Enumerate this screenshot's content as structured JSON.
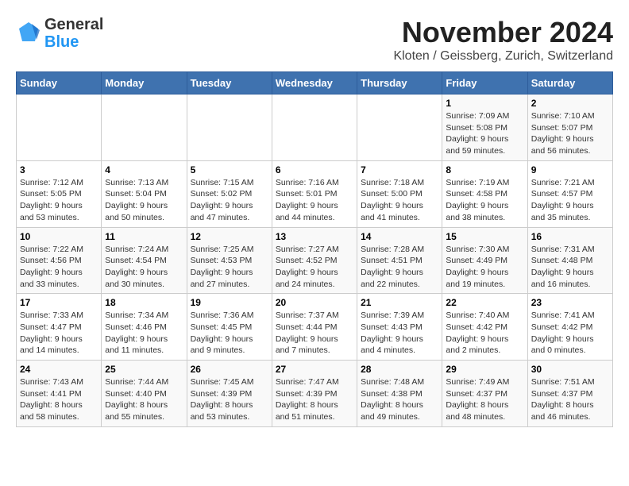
{
  "header": {
    "logo_general": "General",
    "logo_blue": "Blue",
    "month": "November 2024",
    "location": "Kloten / Geissberg, Zurich, Switzerland"
  },
  "weekdays": [
    "Sunday",
    "Monday",
    "Tuesday",
    "Wednesday",
    "Thursday",
    "Friday",
    "Saturday"
  ],
  "weeks": [
    [
      {
        "day": "",
        "info": ""
      },
      {
        "day": "",
        "info": ""
      },
      {
        "day": "",
        "info": ""
      },
      {
        "day": "",
        "info": ""
      },
      {
        "day": "",
        "info": ""
      },
      {
        "day": "1",
        "info": "Sunrise: 7:09 AM\nSunset: 5:08 PM\nDaylight: 9 hours and 59 minutes."
      },
      {
        "day": "2",
        "info": "Sunrise: 7:10 AM\nSunset: 5:07 PM\nDaylight: 9 hours and 56 minutes."
      }
    ],
    [
      {
        "day": "3",
        "info": "Sunrise: 7:12 AM\nSunset: 5:05 PM\nDaylight: 9 hours and 53 minutes."
      },
      {
        "day": "4",
        "info": "Sunrise: 7:13 AM\nSunset: 5:04 PM\nDaylight: 9 hours and 50 minutes."
      },
      {
        "day": "5",
        "info": "Sunrise: 7:15 AM\nSunset: 5:02 PM\nDaylight: 9 hours and 47 minutes."
      },
      {
        "day": "6",
        "info": "Sunrise: 7:16 AM\nSunset: 5:01 PM\nDaylight: 9 hours and 44 minutes."
      },
      {
        "day": "7",
        "info": "Sunrise: 7:18 AM\nSunset: 5:00 PM\nDaylight: 9 hours and 41 minutes."
      },
      {
        "day": "8",
        "info": "Sunrise: 7:19 AM\nSunset: 4:58 PM\nDaylight: 9 hours and 38 minutes."
      },
      {
        "day": "9",
        "info": "Sunrise: 7:21 AM\nSunset: 4:57 PM\nDaylight: 9 hours and 35 minutes."
      }
    ],
    [
      {
        "day": "10",
        "info": "Sunrise: 7:22 AM\nSunset: 4:56 PM\nDaylight: 9 hours and 33 minutes."
      },
      {
        "day": "11",
        "info": "Sunrise: 7:24 AM\nSunset: 4:54 PM\nDaylight: 9 hours and 30 minutes."
      },
      {
        "day": "12",
        "info": "Sunrise: 7:25 AM\nSunset: 4:53 PM\nDaylight: 9 hours and 27 minutes."
      },
      {
        "day": "13",
        "info": "Sunrise: 7:27 AM\nSunset: 4:52 PM\nDaylight: 9 hours and 24 minutes."
      },
      {
        "day": "14",
        "info": "Sunrise: 7:28 AM\nSunset: 4:51 PM\nDaylight: 9 hours and 22 minutes."
      },
      {
        "day": "15",
        "info": "Sunrise: 7:30 AM\nSunset: 4:49 PM\nDaylight: 9 hours and 19 minutes."
      },
      {
        "day": "16",
        "info": "Sunrise: 7:31 AM\nSunset: 4:48 PM\nDaylight: 9 hours and 16 minutes."
      }
    ],
    [
      {
        "day": "17",
        "info": "Sunrise: 7:33 AM\nSunset: 4:47 PM\nDaylight: 9 hours and 14 minutes."
      },
      {
        "day": "18",
        "info": "Sunrise: 7:34 AM\nSunset: 4:46 PM\nDaylight: 9 hours and 11 minutes."
      },
      {
        "day": "19",
        "info": "Sunrise: 7:36 AM\nSunset: 4:45 PM\nDaylight: 9 hours and 9 minutes."
      },
      {
        "day": "20",
        "info": "Sunrise: 7:37 AM\nSunset: 4:44 PM\nDaylight: 9 hours and 7 minutes."
      },
      {
        "day": "21",
        "info": "Sunrise: 7:39 AM\nSunset: 4:43 PM\nDaylight: 9 hours and 4 minutes."
      },
      {
        "day": "22",
        "info": "Sunrise: 7:40 AM\nSunset: 4:42 PM\nDaylight: 9 hours and 2 minutes."
      },
      {
        "day": "23",
        "info": "Sunrise: 7:41 AM\nSunset: 4:42 PM\nDaylight: 9 hours and 0 minutes."
      }
    ],
    [
      {
        "day": "24",
        "info": "Sunrise: 7:43 AM\nSunset: 4:41 PM\nDaylight: 8 hours and 58 minutes."
      },
      {
        "day": "25",
        "info": "Sunrise: 7:44 AM\nSunset: 4:40 PM\nDaylight: 8 hours and 55 minutes."
      },
      {
        "day": "26",
        "info": "Sunrise: 7:45 AM\nSunset: 4:39 PM\nDaylight: 8 hours and 53 minutes."
      },
      {
        "day": "27",
        "info": "Sunrise: 7:47 AM\nSunset: 4:39 PM\nDaylight: 8 hours and 51 minutes."
      },
      {
        "day": "28",
        "info": "Sunrise: 7:48 AM\nSunset: 4:38 PM\nDaylight: 8 hours and 49 minutes."
      },
      {
        "day": "29",
        "info": "Sunrise: 7:49 AM\nSunset: 4:37 PM\nDaylight: 8 hours and 48 minutes."
      },
      {
        "day": "30",
        "info": "Sunrise: 7:51 AM\nSunset: 4:37 PM\nDaylight: 8 hours and 46 minutes."
      }
    ]
  ]
}
